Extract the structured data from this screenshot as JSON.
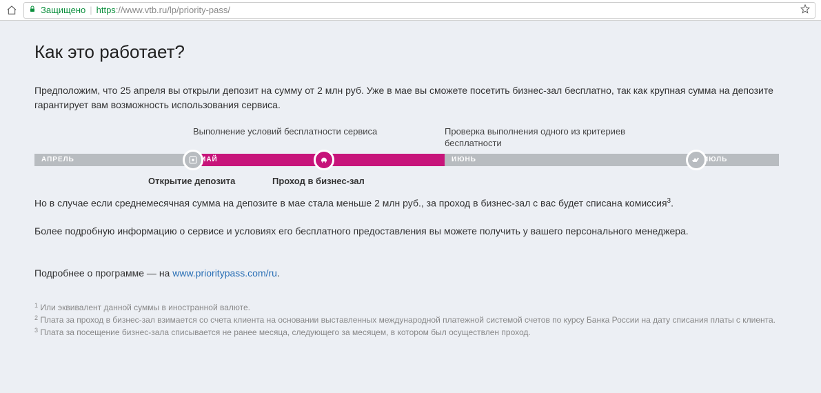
{
  "browser": {
    "secure_label": "Защищено",
    "url_https": "https",
    "url_rest": "://www.vtb.ru/lp/priority-pass/"
  },
  "content": {
    "heading": "Как это работает?",
    "para1": "Предположим, что 25 апреля вы открыли депозит на сумму от 2 млн руб. Уже в мае вы сможете посетить бизнес-зал бесплатно, так как крупная сумма на депозите гарантирует вам возможность использования сервиса.",
    "timeline": {
      "top_label_may": "Выполнение условий бесплатности сервиса",
      "top_label_june": "Проверка выполнения одного из критериев бесплатности",
      "month_april": "АПРЕЛЬ",
      "month_may": "МАЙ",
      "month_june": "ИЮНЬ",
      "month_july": "ИЮЛЬ",
      "bottom_label_deposit": "Открытие депозита",
      "bottom_label_entry": "Проход в бизнес-зал"
    },
    "para2_a": "Но в случае если среднемесячная сумма на депозите в мае стала меньше 2 млн руб., за проход в бизнес-зал с вас будет списана комиссия",
    "para2_sup": "3",
    "para2_b": ".",
    "para3": "Более подробную информацию о сервисе и условиях его бесплатного предоставления вы можете получить у вашего персонального менеджера.",
    "more_prefix": "Подробнее о программе — на  ",
    "more_link": "www.prioritypass.com/ru",
    "more_suffix": "."
  },
  "footnotes": {
    "f1_sup": "1",
    "f1": " Или эквивалент данной суммы в иностранной валюте.",
    "f2_sup": "2",
    "f2": " Плата за проход в бизнес-зал взимается со счета клиента на основании выставленных международной платежной системой счетов по курсу Банка России на дату списания платы с клиента.",
    "f3_sup": "3",
    "f3": " Плата за посещение бизнес-зала списывается не ранее месяца, следующего за месяцем, в котором был осуществлен проход."
  }
}
